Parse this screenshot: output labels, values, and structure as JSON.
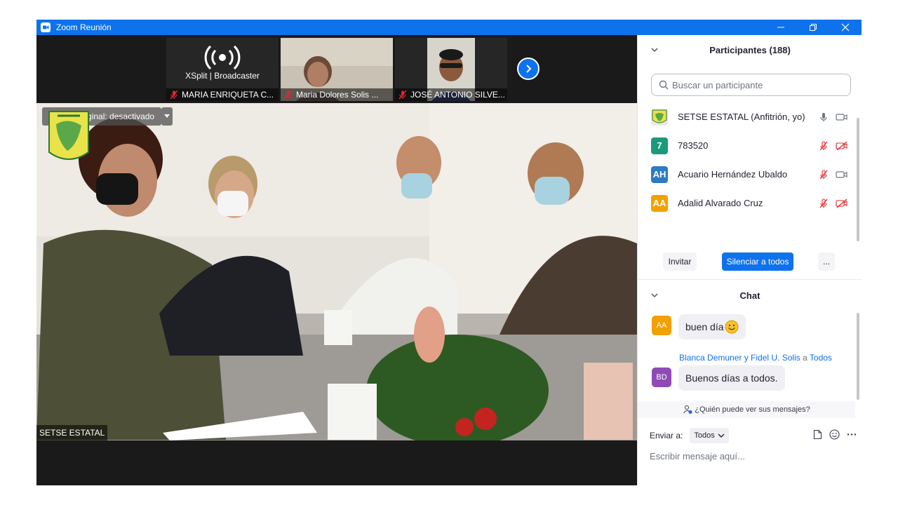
{
  "window": {
    "title": "Zoom Reunión",
    "controls": {
      "minimize": "—",
      "restore": "❐",
      "close": "✕"
    }
  },
  "thumbnails": [
    {
      "name": "MARIA ENRIQUETA C...",
      "logo_text": "XSplit | Broadcaster"
    },
    {
      "name": "Maria Dolores Solis ..."
    },
    {
      "name": "JOSÉ ANTONIO SILVE..."
    }
  ],
  "main_video": {
    "original_sound": "Sonido original: desactivado",
    "speaker": "SETSE ESTATAL"
  },
  "participants": {
    "header": "Participantes (188)",
    "search_placeholder": "Buscar un participante",
    "list": [
      {
        "initials": "",
        "name": "SETSE ESTATAL (Anfitrión, yo)",
        "color": "#e8e8e8",
        "mic": "on",
        "video": "on"
      },
      {
        "initials": "7",
        "name": "783520",
        "color": "#1b9a7a",
        "mic": "muted",
        "video": "off"
      },
      {
        "initials": "AH",
        "name": "Acuario Hernández Ubaldo",
        "color": "#2d7bc4",
        "mic": "muted",
        "video": "on"
      },
      {
        "initials": "AA",
        "name": "Adalid Alvarado Cruz",
        "color": "#f2a100",
        "mic": "muted",
        "video": "off"
      }
    ],
    "invite": "Invitar",
    "mute_all": "Silenciar a todos",
    "more": "..."
  },
  "chat": {
    "header": "Chat",
    "messages": [
      {
        "initials": "AA",
        "color": "#f2a100",
        "text": "buen día"
      },
      {
        "initials": "BD",
        "color": "#8f4bb5",
        "sender": "Blanca Demuner y Fidel U. Solis",
        "to_word": "a",
        "to": "Todos",
        "text": "Buenos días a todos."
      }
    ],
    "who_can_see": "¿Quién puede ver sus mensajes?",
    "send_to_label": "Enviar a:",
    "send_to_value": "Todos",
    "input_placeholder": "Escribir mensaje aquí..."
  },
  "colors": {
    "zoom_blue": "#0e72ed",
    "mute_red": "#e02828"
  }
}
